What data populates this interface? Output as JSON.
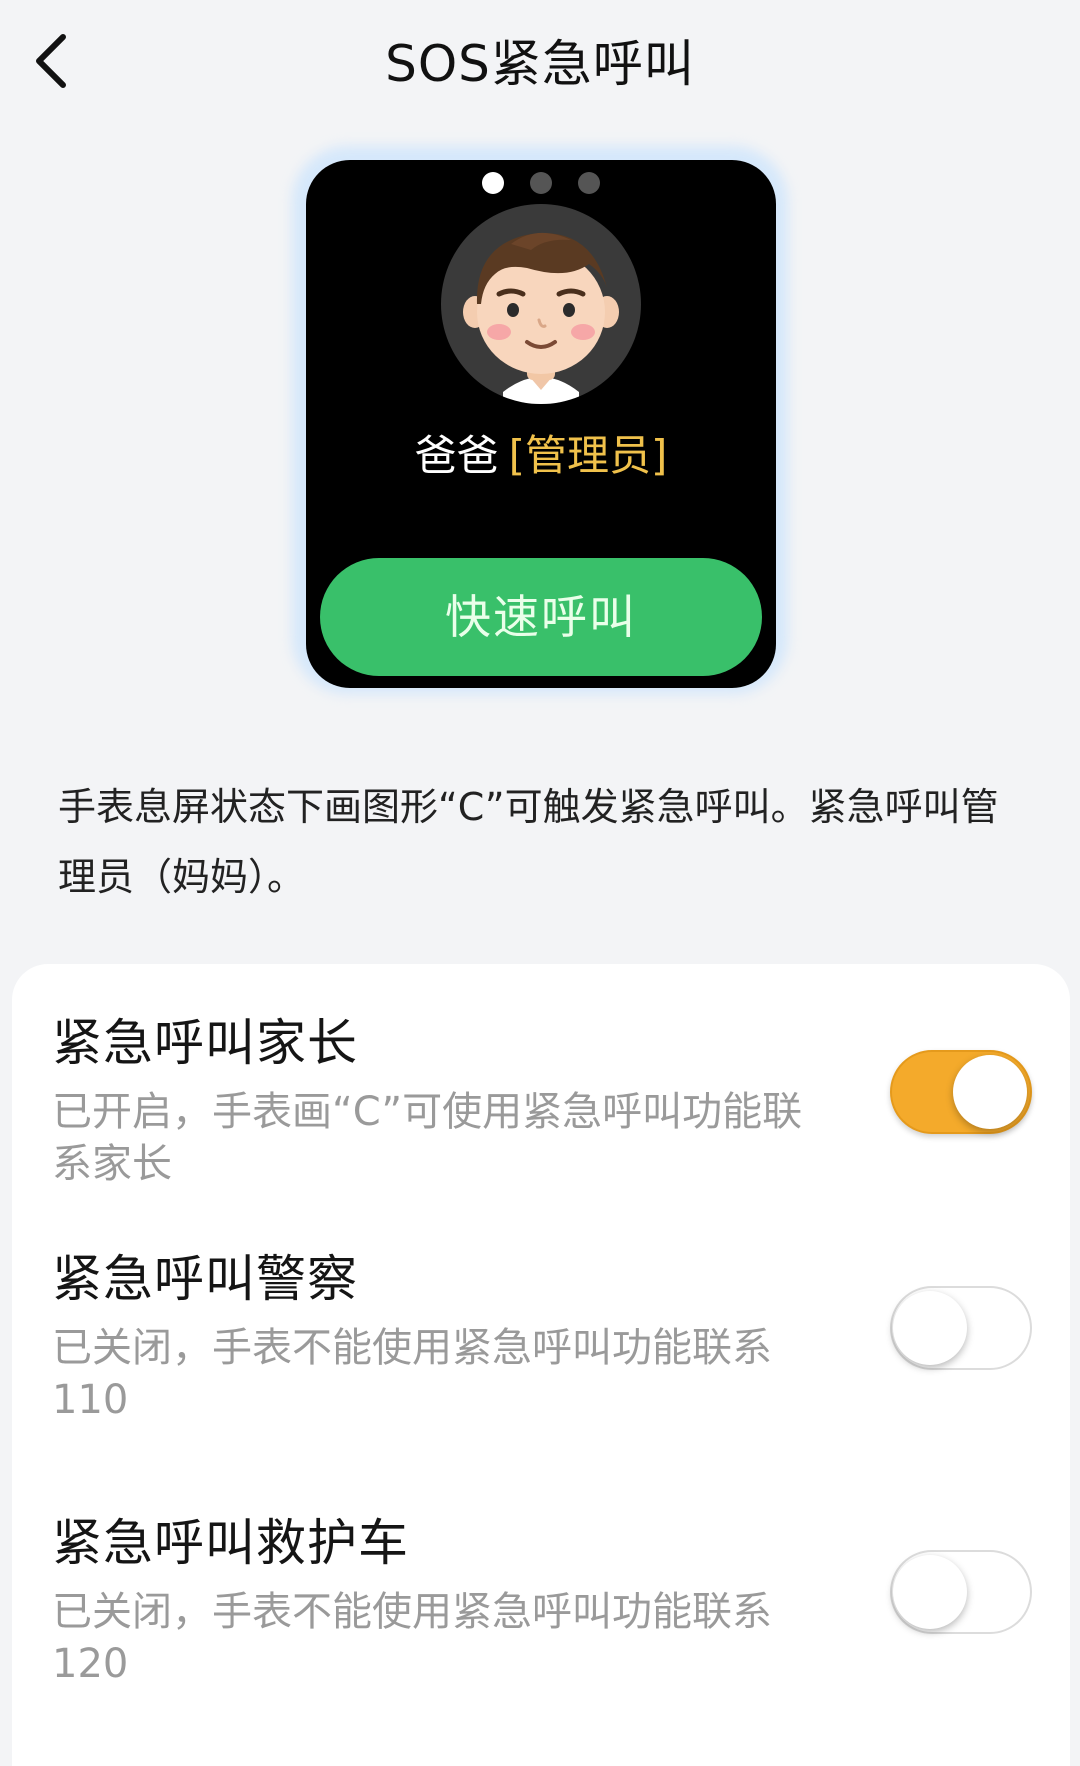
{
  "header": {
    "title": "SOS紧急呼叫",
    "back_icon": "chevron-left-icon"
  },
  "watch": {
    "pager": {
      "total": 3,
      "active_index": 0
    },
    "contact": {
      "name": "爸爸",
      "role": "[管理员]",
      "avatar": "avatar-cartoon-man"
    },
    "quick_call_label": "快速呼叫"
  },
  "description": "手表息屏状态下画图形“C”可触发紧急呼叫。紧急呼叫管理员（妈妈）。",
  "settings": [
    {
      "title": "紧急呼叫家长",
      "desc": "已开启，手表画“C”可使用紧急呼叫功能联系家长",
      "enabled": true
    },
    {
      "title": "紧急呼叫警察",
      "desc": "已关闭，手表不能使用紧急呼叫功能联系110",
      "enabled": false
    },
    {
      "title": "紧急呼叫救护车",
      "desc": "已关闭，手表不能使用紧急呼叫功能联系120",
      "enabled": false
    }
  ],
  "colors": {
    "background": "#f3f4f6",
    "quick_call": "#39c06a",
    "toggle_on": "#f4aa2b",
    "role_text": "#f0c14b"
  }
}
